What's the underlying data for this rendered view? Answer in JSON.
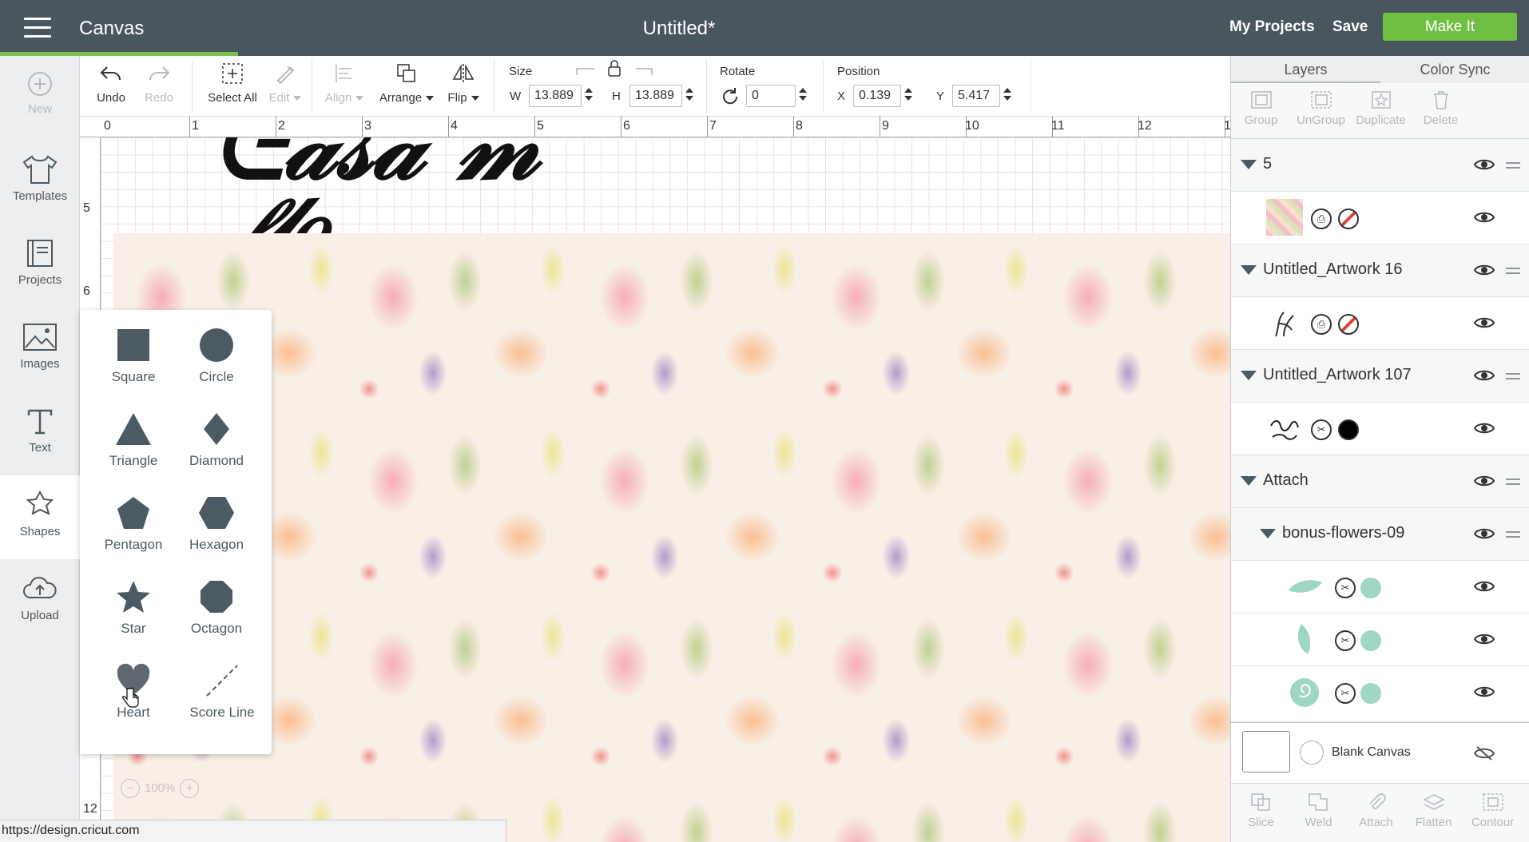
{
  "header": {
    "app_title": "Canvas",
    "doc_title": "Untitled*",
    "my_projects": "My Projects",
    "save": "Save",
    "make_it": "Make It",
    "accent": "#6fbf43"
  },
  "leftbar": [
    {
      "label": "New",
      "icon": "plus-circle-icon"
    },
    {
      "label": "Templates",
      "icon": "tshirt-icon"
    },
    {
      "label": "Projects",
      "icon": "book-icon"
    },
    {
      "label": "Images",
      "icon": "image-icon"
    },
    {
      "label": "Text",
      "icon": "text-icon"
    },
    {
      "label": "Shapes",
      "icon": "shapes-icon"
    },
    {
      "label": "Upload",
      "icon": "cloud-upload-icon"
    }
  ],
  "toolbar": {
    "undo": "Undo",
    "redo": "Redo",
    "select_all": "Select All",
    "edit": "Edit",
    "align": "Align",
    "arrange": "Arrange",
    "flip": "Flip",
    "size_label": "Size",
    "w_label": "W",
    "w_value": "13.889",
    "h_label": "H",
    "h_value": "13.889",
    "rotate_label": "Rotate",
    "rotate_value": "0",
    "position_label": "Position",
    "x_label": "X",
    "x_value": "0.139",
    "y_label": "Y",
    "y_value": "5.417"
  },
  "ruler": {
    "h": [
      "0",
      "1",
      "2",
      "3",
      "4",
      "5",
      "6",
      "7",
      "8",
      "9",
      "10",
      "11",
      "12",
      "1"
    ],
    "v": [
      "5",
      "6",
      "12"
    ]
  },
  "shapes": [
    {
      "label": "Square",
      "icon": "square-icon"
    },
    {
      "label": "Circle",
      "icon": "circle-icon"
    },
    {
      "label": "Triangle",
      "icon": "triangle-icon"
    },
    {
      "label": "Diamond",
      "icon": "diamond-icon"
    },
    {
      "label": "Pentagon",
      "icon": "pentagon-icon"
    },
    {
      "label": "Hexagon",
      "icon": "hexagon-icon"
    },
    {
      "label": "Star",
      "icon": "star-icon"
    },
    {
      "label": "Octagon",
      "icon": "octagon-icon"
    },
    {
      "label": "Heart",
      "icon": "heart-icon"
    },
    {
      "label": "Score Line",
      "icon": "score-line-icon"
    }
  ],
  "zoom": "100%",
  "status_url": "https://design.cricut.com",
  "panel": {
    "tab_layers": "Layers",
    "tab_color_sync": "Color Sync",
    "tools": [
      "Group",
      "UnGroup",
      "Duplicate",
      "Delete"
    ],
    "layers": [
      {
        "name": "5"
      },
      {
        "name": "Untitled_Artwork 16"
      },
      {
        "name": "Untitled_Artwork 107"
      },
      {
        "name": "Attach"
      },
      {
        "name": "bonus-flowers-09"
      }
    ],
    "blank_canvas": "Blank Canvas",
    "bottom_tools": [
      "Slice",
      "Weld",
      "Attach",
      "Flatten",
      "Contour"
    ]
  }
}
